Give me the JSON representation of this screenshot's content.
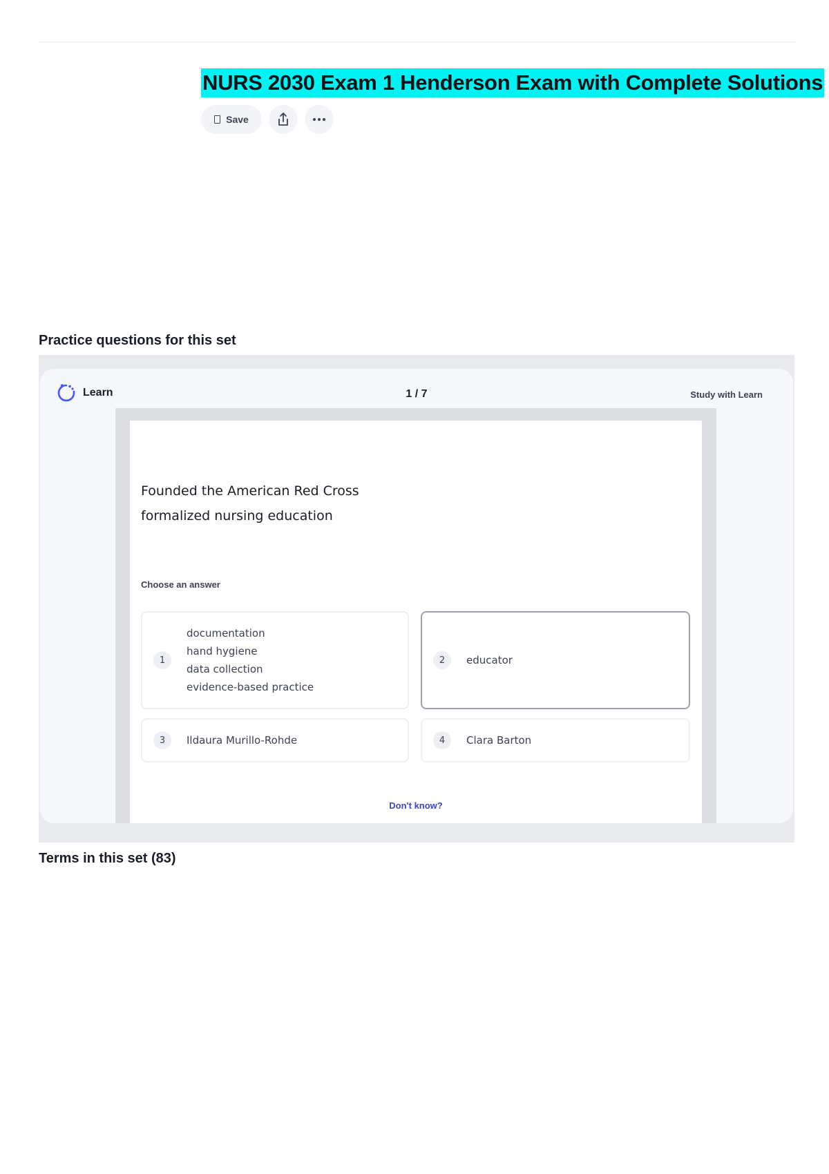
{
  "page": {
    "title": "NURS 2030 Exam 1 Henderson Exam with Complete Solutions",
    "actions": {
      "save_label": "Save",
      "share_icon": "share-icon",
      "more_icon": "more-horizontal-icon"
    }
  },
  "practice": {
    "heading": "Practice questions for this set",
    "mode_label": "Learn",
    "counter": "1 / 7",
    "study_link": "Study with Learn",
    "prompt_lines": [
      "Founded the American Red Cross",
      "formalized nursing education"
    ],
    "choose_label": "Choose an answer",
    "answers": [
      {
        "number": "1",
        "lines": [
          "documentation",
          "hand hygiene",
          "data collection",
          "evidence-based  practice"
        ],
        "selected": false
      },
      {
        "number": "2",
        "lines": [
          "educator"
        ],
        "selected": true
      },
      {
        "number": "3",
        "lines": [
          "Ildaura Murillo-Rohde"
        ],
        "selected": false
      },
      {
        "number": "4",
        "lines": [
          "Clara Barton"
        ],
        "selected": false
      }
    ],
    "dont_know": "Don't know?"
  },
  "terms": {
    "heading": "Terms in this set (83)"
  },
  "colors": {
    "title_highlight": "#00f2f2",
    "accent_link": "#3b47b8",
    "learn_icon": "#4255ff"
  }
}
